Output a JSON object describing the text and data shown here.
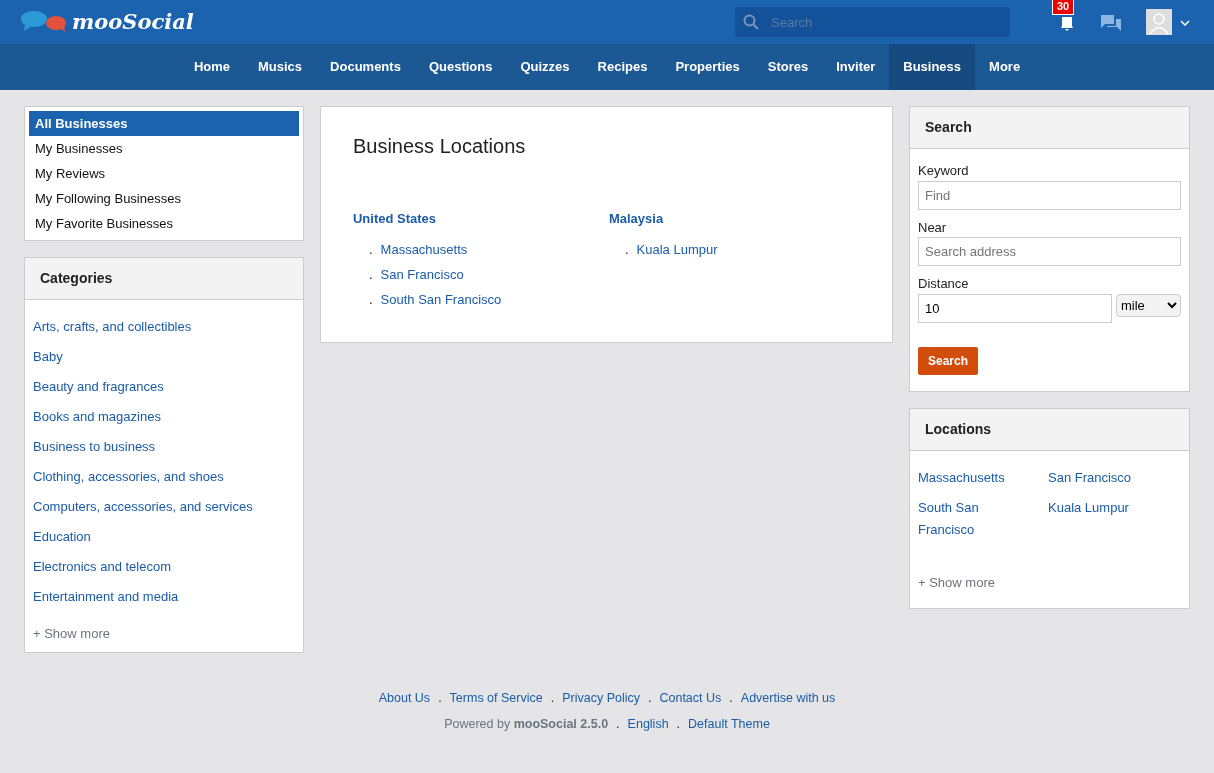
{
  "header": {
    "logo_text": "mooSocial",
    "search_placeholder": "Search",
    "notification_count": "30"
  },
  "nav": [
    {
      "label": "Home",
      "selected": false
    },
    {
      "label": "Musics",
      "selected": false
    },
    {
      "label": "Documents",
      "selected": false
    },
    {
      "label": "Questions",
      "selected": false
    },
    {
      "label": "Quizzes",
      "selected": false
    },
    {
      "label": "Recipes",
      "selected": false
    },
    {
      "label": "Properties",
      "selected": false
    },
    {
      "label": "Stores",
      "selected": false
    },
    {
      "label": "Inviter",
      "selected": false
    },
    {
      "label": "Business",
      "selected": true
    },
    {
      "label": "More",
      "selected": false
    }
  ],
  "sidebar_menu": [
    {
      "label": "All Businesses",
      "selected": true
    },
    {
      "label": "My Businesses",
      "selected": false
    },
    {
      "label": "My Reviews",
      "selected": false
    },
    {
      "label": "My Following Businesses",
      "selected": false
    },
    {
      "label": "My Favorite Businesses",
      "selected": false
    }
  ],
  "categories": {
    "title": "Categories",
    "items": [
      "Arts, crafts, and collectibles",
      "Baby",
      "Beauty and fragrances",
      "Books and magazines",
      "Business to business",
      "Clothing, accessories, and shoes",
      "Computers, accessories, and services",
      "Education",
      "Electronics and telecom",
      "Entertainment and media"
    ],
    "show_more": "+ Show more"
  },
  "business_locations": {
    "title": "Business Locations",
    "bullet": ".",
    "countries": [
      {
        "name": "United States",
        "cities": [
          "Massachusetts",
          "San Francisco",
          "South San Francisco"
        ]
      },
      {
        "name": "Malaysia",
        "cities": [
          "Kuala Lumpur"
        ]
      }
    ]
  },
  "search_panel": {
    "title": "Search",
    "keyword_label": "Keyword",
    "keyword_placeholder": "Find",
    "near_label": "Near",
    "near_placeholder": "Search address",
    "distance_label": "Distance",
    "distance_value": "10",
    "unit": "mile",
    "button": "Search"
  },
  "locations": {
    "title": "Locations",
    "items": [
      "Massachusetts",
      "San Francisco",
      "South San Francisco",
      "Kuala Lumpur"
    ],
    "show_more": "+ Show more"
  },
  "footer": {
    "separator": ".",
    "links": [
      "About Us",
      "Terms of Service",
      "Privacy Policy",
      "Contact Us",
      "Advertise with us"
    ],
    "powered_by": "Powered by **mooSocial 2.5.0**",
    "language": "English",
    "theme": "Default Theme"
  }
}
